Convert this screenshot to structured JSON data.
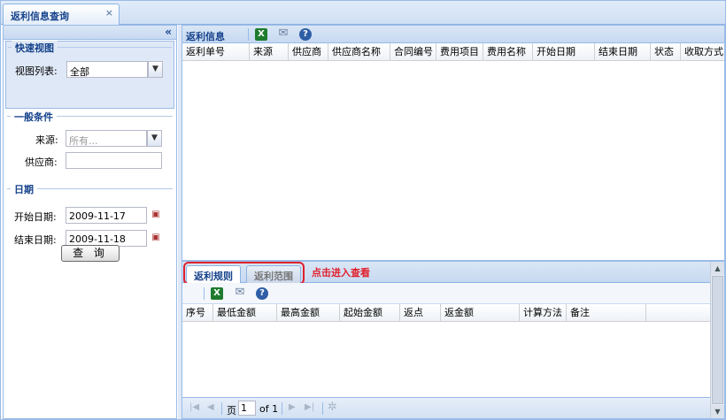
{
  "window": {
    "tab_title": "返利信息查询",
    "tab_close": "×"
  },
  "left_panel": {
    "collapse": "«",
    "quick_view": {
      "legend": "快速视图",
      "view_list_label": "视图列表:",
      "view_list_value": "全部"
    },
    "general": {
      "legend": "一般条件",
      "source_label": "来源:",
      "source_placeholder": "所有...",
      "supplier_label": "供应商:",
      "supplier_value": ""
    },
    "date": {
      "legend": "日期",
      "start_label": "开始日期:",
      "start_value": "2009-11-17",
      "end_label": "结束日期:",
      "end_value": "2009-11-18"
    },
    "search_button": "查 询"
  },
  "main_panel": {
    "title": "返利信息",
    "columns": [
      "返利单号",
      "来源",
      "供应商",
      "供应商名称",
      "合同编号",
      "费用项目",
      "费用名称",
      "开始日期",
      "结束日期",
      "状态",
      "收取方式"
    ]
  },
  "detail_panel": {
    "tabs": [
      {
        "label": "返利规则",
        "active": true
      },
      {
        "label": "返利范围",
        "active": false
      }
    ],
    "note": "点击进入查看",
    "columns": [
      "序号",
      "最低金额",
      "最高金额",
      "起始金额",
      "返点",
      "返金额",
      "计算方法",
      "备注"
    ],
    "pager": {
      "page_label": "页",
      "page_value": "1",
      "of_label": "of 1"
    }
  },
  "colors": {
    "accent": "#15428b",
    "border": "#99bbe8",
    "annotation": "#e0202c"
  }
}
